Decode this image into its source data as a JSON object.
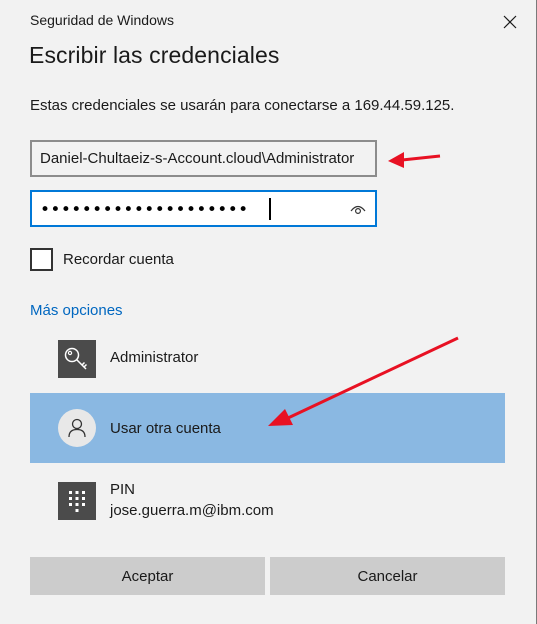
{
  "window": {
    "title": "Seguridad de Windows",
    "close_icon": "close-icon"
  },
  "dialog": {
    "heading": "Escribir las credenciales",
    "description": "Estas credenciales se usarán para conectarse a 169.44.59.125."
  },
  "username_field": {
    "value": "Daniel-Chultaeiz-s-Account.cloud\\Administrator"
  },
  "password_field": {
    "masked_value": "••••••••••••••••••••",
    "reveal_icon": "eye-icon"
  },
  "remember": {
    "label": "Recordar cuenta",
    "checked": false
  },
  "more_options": {
    "label": "Más opciones"
  },
  "accounts": [
    {
      "icon": "key-icon",
      "label": "Administrator"
    },
    {
      "icon": "user-icon",
      "label": "Usar otra cuenta",
      "selected": true
    },
    {
      "icon": "keypad-icon",
      "label": "PIN",
      "sublabel": "jose.guerra.m@ibm.com"
    }
  ],
  "buttons": {
    "ok": "Aceptar",
    "cancel": "Cancelar"
  },
  "colors": {
    "selected_row": "#8ab8e2",
    "link": "#0067c0",
    "focus_border": "#0078d7",
    "annotation_arrow": "#e81123"
  }
}
